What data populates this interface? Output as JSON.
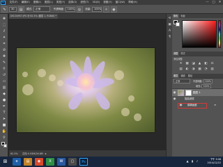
{
  "app": {
    "logo": "Ps",
    "menu": [
      "文件(F)",
      "编辑(E)",
      "图像(I)",
      "图层(L)",
      "类型(Y)",
      "选择(S)",
      "滤镜(T)",
      "3D(D)",
      "视图(V)",
      "窗口(W)",
      "帮助(H)"
    ],
    "window_controls": [
      "—",
      "□",
      "✕"
    ]
  },
  "options_bar": {
    "brush_size": "30",
    "mode_label": "模式:",
    "mode_value": "正常",
    "opacity_label": "不透明度:",
    "opacity_value": "100%",
    "flow_label": "流量:",
    "flow_value": "100%"
  },
  "document": {
    "tab_title": "DSC04957.JPG @ 62.5% (图层 1, RGB/8) *",
    "zoom": "62.5%",
    "doc_info": "文档:5.93M/26.8M"
  },
  "panels": {
    "color_tabs": [
      "颜色",
      "色板"
    ],
    "adjust_tabs": [
      "调整",
      "样式"
    ],
    "adjust_title": "添加调整",
    "adjust_icons": [
      "☀",
      "▦",
      "◪",
      "▲",
      "◧",
      "⚖",
      "▤",
      "◐",
      "◑",
      "▩",
      "◔",
      "▥"
    ],
    "layers_tabs": [
      "图层",
      "通道",
      "路径"
    ],
    "blend_mode": "正常",
    "opacity_label": "不透明度:",
    "opacity_value": "100%",
    "fill_label": "填充:",
    "fill_value": "100%",
    "layers": [
      {
        "name": "图层 1"
      },
      {
        "name": "智能滤镜"
      },
      {
        "name": "模糊画廊"
      }
    ]
  },
  "taskbar": {
    "time": "下午 3:08",
    "date": "2014/12/22"
  },
  "colors": {
    "accent": "#31a8ff",
    "selection_box": "#d23b3b",
    "taskbar": "#17263d"
  }
}
